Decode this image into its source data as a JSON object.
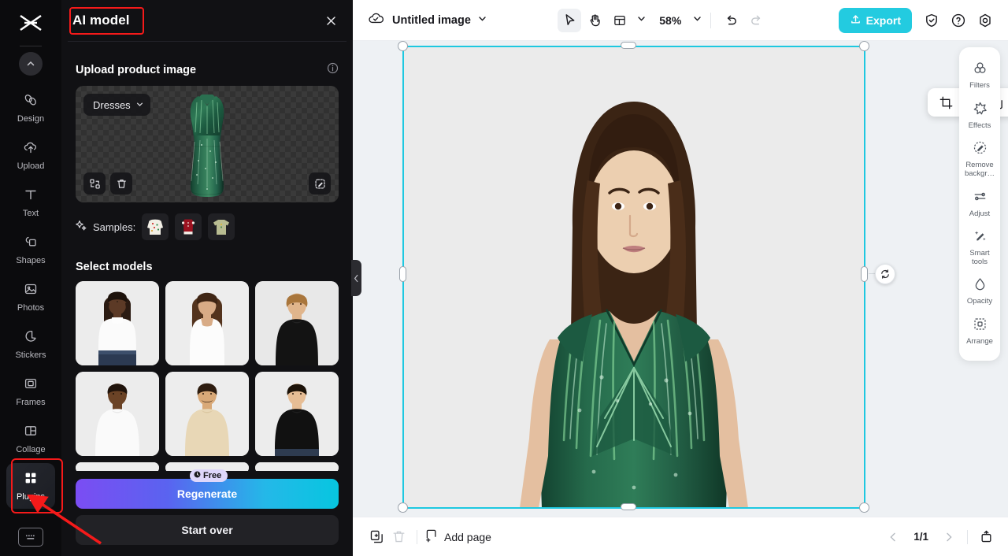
{
  "left_rail": {
    "logo_name": "capcut-logo",
    "collapse_label": "collapse-sidebar",
    "items": [
      {
        "label": "Design",
        "icon": "design-icon"
      },
      {
        "label": "Upload",
        "icon": "upload-cloud-icon"
      },
      {
        "label": "Text",
        "icon": "text-icon"
      },
      {
        "label": "Shapes",
        "icon": "shapes-icon"
      },
      {
        "label": "Photos",
        "icon": "photos-icon"
      },
      {
        "label": "Stickers",
        "icon": "stickers-icon"
      },
      {
        "label": "Frames",
        "icon": "frames-icon"
      },
      {
        "label": "Collage",
        "icon": "collage-icon"
      },
      {
        "label": "Plugins",
        "icon": "plugins-grid-icon"
      }
    ],
    "active_item": "Plugins",
    "keyboard_shortcut_icon": "keyboard-icon",
    "highlight_color": "#f51a1a"
  },
  "panel": {
    "title": "AI model",
    "close_icon": "close-icon",
    "upload_section": {
      "heading": "Upload product image",
      "info_icon": "info-icon",
      "category_value": "Dresses",
      "category_chevron": "chevron-down-icon",
      "replace_icon": "replace-image-icon",
      "delete_icon": "trash-icon",
      "edit_icon": "magic-edit-icon",
      "product_alt": "green-sequin-dress"
    },
    "samples": {
      "label": "Samples:",
      "sparkle_icon": "sparkle-icon",
      "items": [
        "white-knit-sweater",
        "red-dress",
        "olive-tshirt"
      ]
    },
    "models_section": {
      "heading": "Select models",
      "cards": [
        "female-model-dark-skin-white-top",
        "female-model-brunette-white-tank",
        "male-model-blonde-black-sweater",
        "male-model-dark-skin-white-tee",
        "male-model-beige-tee",
        "male-model-black-tee"
      ]
    },
    "actions": {
      "free_badge": "Free",
      "free_badge_icon": "clock-icon",
      "regenerate_label": "Regenerate",
      "start_over_label": "Start over"
    },
    "collapse_handle_icon": "chevron-left-icon"
  },
  "topbar": {
    "cloud_saved_icon": "cloud-check-icon",
    "document_name": "Untitled image",
    "name_chevron": "chevron-down-icon",
    "tools": [
      {
        "name": "select-tool",
        "icon": "cursor-arrow-icon",
        "active": true
      },
      {
        "name": "hand-tool",
        "icon": "hand-icon",
        "active": false
      },
      {
        "name": "layout-tool",
        "icon": "layout-icon",
        "active": false
      }
    ],
    "layout_chevron": "chevron-down-icon",
    "zoom_value": "58%",
    "zoom_chevron": "chevron-down-icon",
    "undo_icon": "undo-icon",
    "redo_icon": "redo-icon",
    "redo_disabled": true,
    "export_label": "Export",
    "export_icon": "export-upload-icon",
    "export_color": "#23cbe0",
    "shield_icon": "shield-check-icon",
    "help_icon": "help-circle-icon",
    "settings_icon": "settings-gear-icon"
  },
  "canvas": {
    "selection_color": "#1ec8e0",
    "floating_toolbar": [
      {
        "name": "crop-icon"
      },
      {
        "name": "replace-image-icon"
      },
      {
        "name": "duplicate-icon"
      },
      {
        "name": "more-options-icon"
      }
    ],
    "rotate_handle_icon": "rotate-icon",
    "artwork_alt": "ai-model-wearing-green-sequin-dress"
  },
  "right_panel": {
    "items": [
      {
        "label": "Filters",
        "icon": "filters-icon"
      },
      {
        "label": "Effects",
        "icon": "effects-star-icon"
      },
      {
        "label": "Remove backgr…",
        "icon": "remove-background-icon"
      },
      {
        "label": "Adjust",
        "icon": "adjust-sliders-icon"
      },
      {
        "label": "Smart tools",
        "icon": "smart-tools-wand-icon"
      },
      {
        "label": "Opacity",
        "icon": "opacity-drop-icon"
      },
      {
        "label": "Arrange",
        "icon": "arrange-icon"
      }
    ]
  },
  "bottombar": {
    "duplicate_page_icon": "duplicate-page-icon",
    "delete_page_icon": "trash-icon",
    "add_page_label": "Add page",
    "add_page_icon": "add-page-icon",
    "prev_icon": "chevron-left-icon",
    "page_indicator": "1/1",
    "next_icon": "chevron-right-icon",
    "present_icon": "present-icon"
  }
}
